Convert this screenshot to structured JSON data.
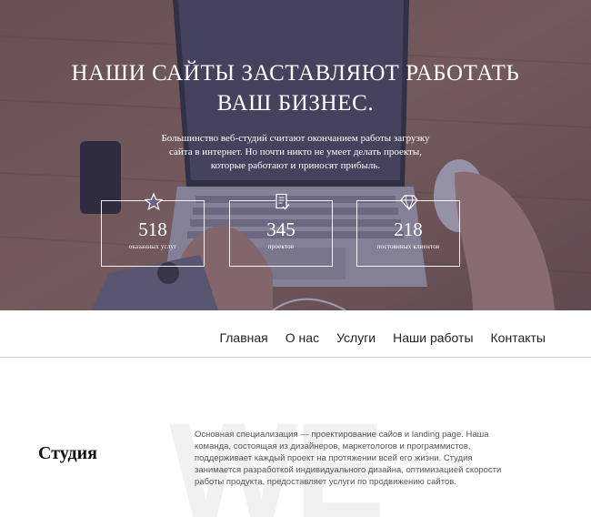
{
  "hero": {
    "title_lines": [
      "НАШИ САЙТЫ ЗАСТАВЛЯЮТ РАБОТАТЬ",
      "ВАШ БИЗНЕС."
    ],
    "description_lines": [
      "Большинство веб-студий считают окончанием работы загрузку",
      "сайта в интернет. Но почти никто не умеет делать проекты,",
      "которые работают и приносят прибыль."
    ],
    "stats": [
      {
        "icon": "star-icon",
        "number": "518",
        "label": "оказанных услуг"
      },
      {
        "icon": "document-check-icon",
        "number": "345",
        "label": "проектов"
      },
      {
        "icon": "diamond-icon",
        "number": "218",
        "label": "постоянных клиентов"
      }
    ]
  },
  "nav": {
    "items": [
      "Главная",
      "О нас",
      "Услуги",
      "Наши работы",
      "Контакты"
    ]
  },
  "about": {
    "title": "Студия",
    "text_lines": [
      "Основная специализация — проектирование сайов и landing page. Наша",
      "команда, состоящая из дизайнеров, маркетологов и программистов,",
      "поддерживает каждый проект на протяжении всей его жизни. Студия",
      "занимается разработкой индивидуального дизайна, оптимизацией скорости",
      "работы продукта, предоставляет услуги по продвижению сайтов."
    ],
    "watermark": "WE"
  },
  "colors": {
    "overlay": "#3c3456",
    "nav_text": "#222222",
    "body_text": "#555555"
  }
}
